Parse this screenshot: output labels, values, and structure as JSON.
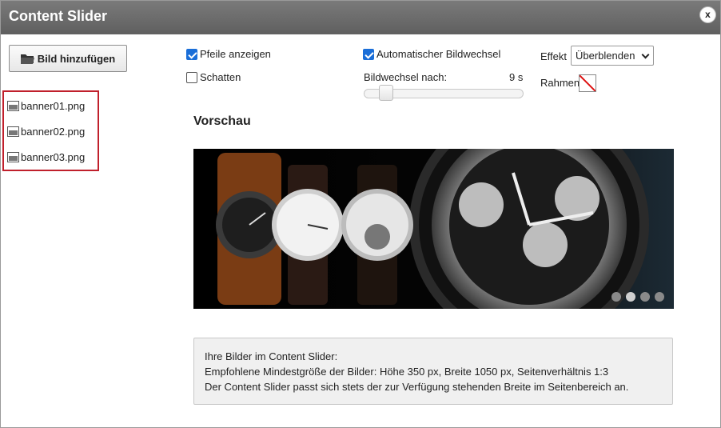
{
  "dialog": {
    "title": "Content Slider",
    "close_label": "x"
  },
  "sidebar": {
    "add_button_label": "Bild hinzufügen",
    "files": [
      "banner01.png",
      "banner02.png",
      "banner03.png"
    ]
  },
  "options": {
    "show_arrows": {
      "label": "Pfeile anzeigen",
      "checked": true
    },
    "shadow": {
      "label": "Schatten",
      "checked": false
    },
    "auto_change": {
      "label": "Automatischer Bildwechsel",
      "checked": true
    },
    "interval_label": "Bildwechsel nach:",
    "interval_value": "9 s",
    "effect_label": "Effekt",
    "effect_value": "Überblenden",
    "frame_label": "Rahmen"
  },
  "preview": {
    "title": "Vorschau",
    "slide_count": 4,
    "active_slide": 1
  },
  "info": {
    "line1": "Ihre Bilder im Content Slider:",
    "line2": "Empfohlene Mindestgröße der Bilder: Höhe 350 px, Breite 1050 px, Seitenverhältnis 1:3",
    "line3": "Der Content Slider passt sich stets der zur Verfügung stehenden Breite im Seitenbereich an."
  },
  "colors": {
    "titlebar": "#6b6b6b",
    "checkbox": "#1a6ed8",
    "highlight_border": "#c0202c"
  }
}
